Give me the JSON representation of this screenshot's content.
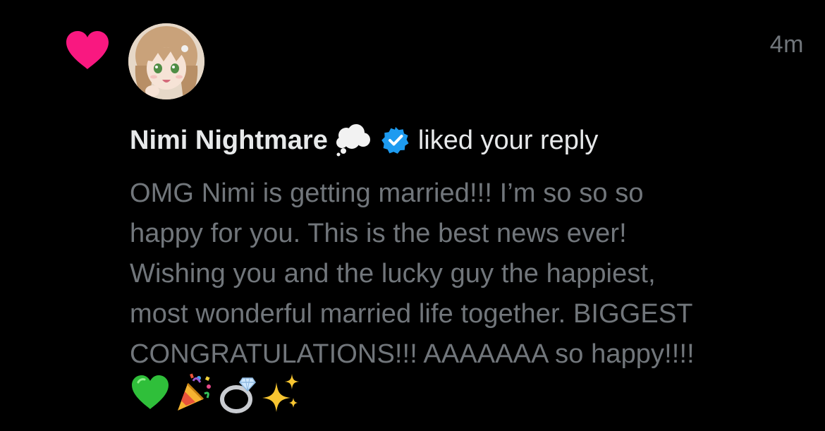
{
  "notification": {
    "type": "like",
    "timestamp": "4m",
    "user": {
      "display_name": "Nimi Nightmare",
      "name_emoji_icon": "thought-balloon-icon",
      "verified": true,
      "verified_badge_icon": "verified-badge-icon"
    },
    "action_text": "liked your reply",
    "reply_lines": [
      "OMG Nimi is getting married!!! I’m so so so",
      "happy for you. This is the best news ever!",
      "Wishing you and the lucky guy the happiest,",
      "most wonderful married life together. BIGGEST",
      "CONGRATULATIONS!!! AAAAAAA so happy!!!!"
    ],
    "reply_emojis": [
      "green-heart-icon",
      "party-popper-icon",
      "ring-icon",
      "sparkles-icon"
    ]
  },
  "colors": {
    "background": "#000000",
    "like_heart": "#f91880",
    "primary_text": "#e7e9ea",
    "secondary_text": "#71767b",
    "verified_blue": "#1d9bf0"
  }
}
